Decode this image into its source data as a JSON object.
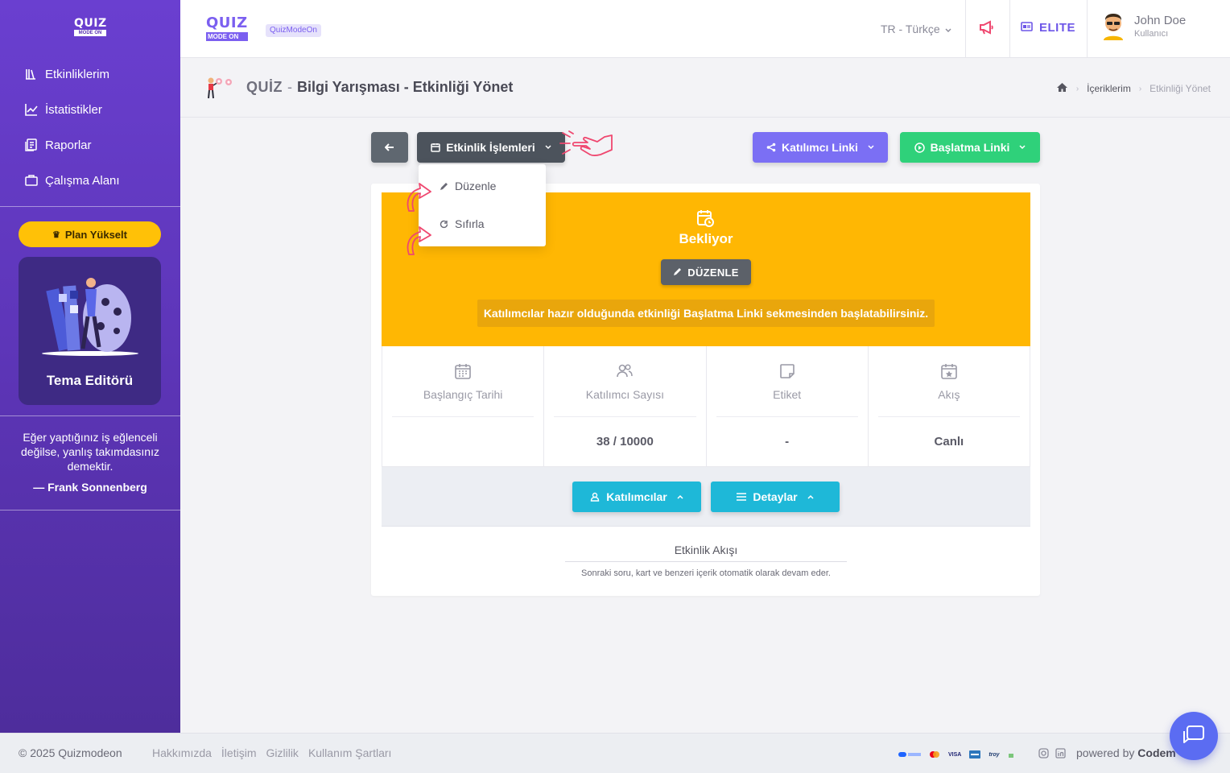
{
  "brand": {
    "logo_word": "QUIZ",
    "logo_tag": "MODE ON",
    "chip": "QuizModeOn"
  },
  "sidebar": {
    "items": [
      {
        "label": "Etkinliklerim",
        "icon": "library-icon"
      },
      {
        "label": "İstatistikler",
        "icon": "chart-line-icon"
      },
      {
        "label": "Raporlar",
        "icon": "report-icon"
      },
      {
        "label": "Çalışma Alanı",
        "icon": "briefcase-icon"
      }
    ],
    "plan_button": "Plan Yükselt",
    "theme_card_title": "Tema Editörü",
    "quote": "Eğer yaptığınız iş eğlenceli değilse, yanlış takımdasınız demektir.",
    "quote_author": "— Frank Sonnenberg"
  },
  "topbar": {
    "language": "TR - Türkçe",
    "plan_badge": "ELITE",
    "user_name": "John Doe",
    "user_role": "Kullanıcı"
  },
  "page_header": {
    "app": "QUİZ",
    "separator": "-",
    "title": "Bilgi Yarışması - Etkinliği Yönet",
    "breadcrumb": [
      "İçeriklerim",
      "Etkinliği Yönet"
    ]
  },
  "actions": {
    "operations": "Etkinlik İşlemleri",
    "participant_link": "Katılımcı Linki",
    "start_link": "Başlatma Linki"
  },
  "dropdown": {
    "items": [
      "Düzenle",
      "Sıfırla"
    ]
  },
  "status": {
    "label": "Bekliyor",
    "edit_button": "DÜZENLE",
    "note": "Katılımcılar hazır olduğunda etkinliği Başlatma Linki sekmesinden başlatabilirsiniz."
  },
  "stats": [
    {
      "label": "Başlangıç Tarihi",
      "value": ""
    },
    {
      "label": "Katılımcı Sayısı",
      "value": "38 / 10000"
    },
    {
      "label": "Etiket",
      "value": "-"
    },
    {
      "label": "Akış",
      "value": "Canlı"
    }
  ],
  "toggles": {
    "participants": "Katılımcılar",
    "details": "Detaylar"
  },
  "flow": {
    "title": "Etkinlik Akışı",
    "description": "Sonraki soru, kart ve benzeri içerik otomatik olarak devam eder."
  },
  "footer": {
    "copyright": "© 2025 Quizmodeon",
    "links": [
      "Hakkımızda",
      "İletişim",
      "Gizlilik",
      "Kullanım Şartları"
    ],
    "payment_logos": [
      "VISA",
      "troy"
    ],
    "powered_by": "powered by",
    "powered_name": "Codem"
  },
  "colors": {
    "sidebar": "#6a3fd0",
    "status_panel": "#ffb703",
    "participant_link": "#7b6ff4",
    "start_link": "#2fd17a",
    "toggle": "#1eb8d8",
    "accent": "#6d56e8"
  }
}
